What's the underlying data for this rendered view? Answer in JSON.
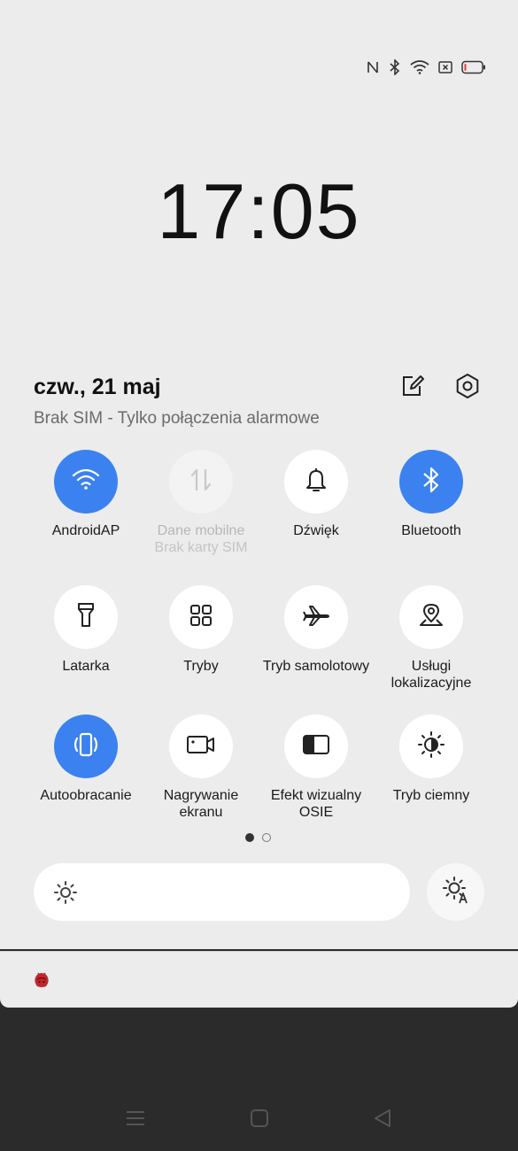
{
  "status_bar": {
    "icons": [
      "nfc-icon",
      "bluetooth-icon",
      "wifi-icon",
      "no-sim-icon",
      "battery-low-icon"
    ]
  },
  "clock": "17:05",
  "header": {
    "date": "czw., 21 maj",
    "sim_status": "Brak SIM - Tylko połączenia alarmowe",
    "edit_icon": "edit-icon",
    "settings_icon": "settings-icon"
  },
  "tiles": [
    {
      "label": "AndroidAP",
      "sub": "",
      "state": "on",
      "icon": "wifi-icon"
    },
    {
      "label": "Dane mobilne",
      "sub": "Brak karty SIM",
      "state": "disabled",
      "icon": "mobile-data-icon"
    },
    {
      "label": "Dźwięk",
      "sub": "",
      "state": "off",
      "icon": "bell-icon"
    },
    {
      "label": "Bluetooth",
      "sub": "",
      "state": "on",
      "icon": "bluetooth-icon"
    },
    {
      "label": "Latarka",
      "sub": "",
      "state": "off",
      "icon": "flashlight-icon"
    },
    {
      "label": "Tryby",
      "sub": "",
      "state": "off",
      "icon": "modes-grid-icon"
    },
    {
      "label": "Tryb samolotowy",
      "sub": "",
      "state": "off",
      "icon": "airplane-icon"
    },
    {
      "label": "Usługi lokalizacyjne",
      "sub": "",
      "state": "off",
      "icon": "location-icon"
    },
    {
      "label": "Autoobracanie",
      "sub": "",
      "state": "on",
      "icon": "auto-rotate-icon"
    },
    {
      "label": "Nagrywanie ekranu",
      "sub": "",
      "state": "off",
      "icon": "screen-record-icon"
    },
    {
      "label": "Efekt wizualny OSIE",
      "sub": "",
      "state": "off",
      "icon": "osie-effect-icon"
    },
    {
      "label": "Tryb ciemny",
      "sub": "",
      "state": "off",
      "icon": "dark-mode-icon"
    }
  ],
  "page_indicator": {
    "current": 1,
    "total": 2
  },
  "brightness": {
    "level": 0.0,
    "auto_icon": "auto-brightness-icon"
  },
  "notification": {
    "app_icon": "antutu-icon"
  },
  "colors": {
    "accent": "#3b82f0",
    "panel": "#ececec",
    "navbar": "#2b2b2b"
  }
}
